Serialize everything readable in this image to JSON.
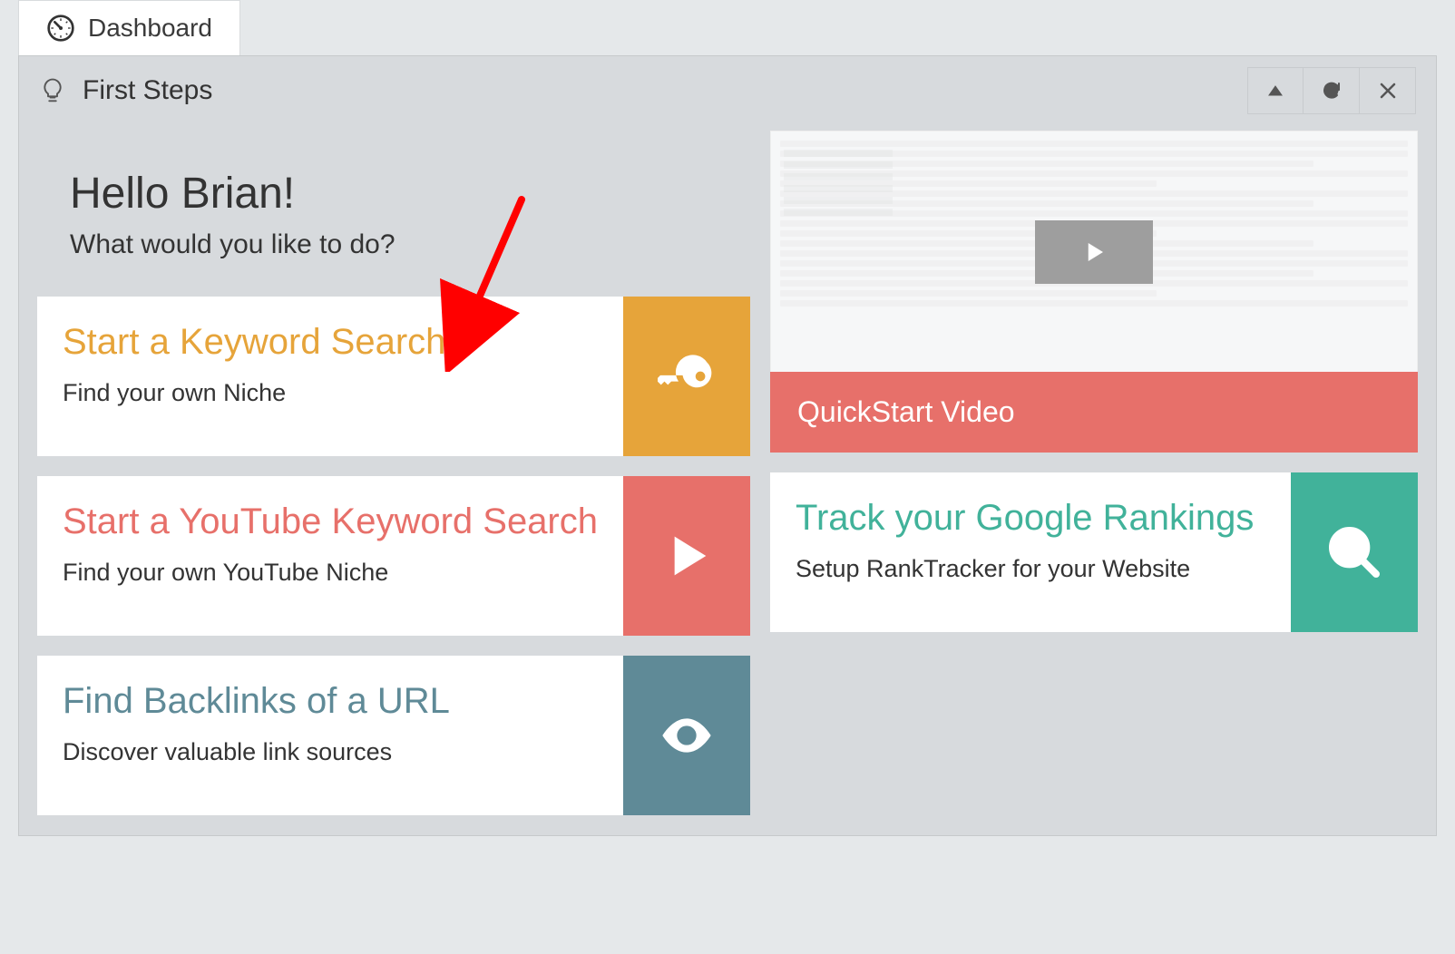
{
  "tab": {
    "label": "Dashboard"
  },
  "panel": {
    "title": "First Steps"
  },
  "greeting": {
    "hello": "Hello Brian!",
    "sub": "What would you like to do?"
  },
  "cards": {
    "keyword": {
      "title": "Start a Keyword Search",
      "sub": "Find your own Niche"
    },
    "youtube": {
      "title": "Start a YouTube Keyword Search",
      "sub": "Find your own YouTube Niche"
    },
    "backlink": {
      "title": "Find Backlinks of a URL",
      "sub": "Discover valuable link sources"
    },
    "rank": {
      "title": "Track your Google Rankings",
      "sub": "Setup RankTracker for your Website"
    }
  },
  "video": {
    "label": "QuickStart Video"
  },
  "colors": {
    "orange": "#e6a43a",
    "red": "#e7706a",
    "slate": "#5f8a97",
    "teal": "#41b29a"
  }
}
